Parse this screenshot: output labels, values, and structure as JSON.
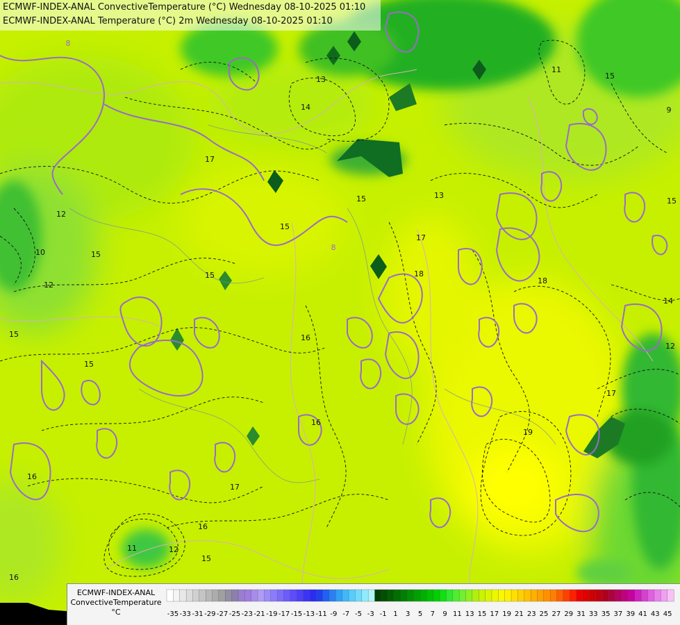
{
  "map": {
    "title_lines": [
      "ECMWF-INDEX-ANAL ConvectiveTemperature (°C) Wednesday 08-10-2025 01:10",
      "ECMWF-INDEX-ANAL Temperature (°C) 2m Wednesday 08-10-2025 01:10"
    ],
    "contour_labels": [
      {
        "text": "17",
        "color": "black"
      },
      {
        "text": "15",
        "color": "black"
      },
      {
        "text": "15",
        "color": "black"
      },
      {
        "text": "16",
        "color": "black"
      },
      {
        "text": "13",
        "color": "black"
      },
      {
        "text": "13",
        "color": "black"
      },
      {
        "text": "14",
        "color": "black"
      },
      {
        "text": "15",
        "color": "black"
      },
      {
        "text": "15",
        "color": "black"
      },
      {
        "text": "18",
        "color": "black"
      },
      {
        "text": "17",
        "color": "black"
      },
      {
        "text": "18",
        "color": "black"
      },
      {
        "text": "16",
        "color": "black"
      },
      {
        "text": "16",
        "color": "black"
      },
      {
        "text": "19",
        "color": "black"
      },
      {
        "text": "17",
        "color": "black"
      },
      {
        "text": "16",
        "color": "black"
      },
      {
        "text": "15",
        "color": "black"
      },
      {
        "text": "16",
        "color": "black"
      },
      {
        "text": "15",
        "color": "black"
      },
      {
        "text": "12",
        "color": "black"
      },
      {
        "text": "10",
        "color": "black"
      },
      {
        "text": "12",
        "color": "black"
      },
      {
        "text": "15",
        "color": "black"
      },
      {
        "text": "14",
        "color": "black"
      },
      {
        "text": "15",
        "color": "black"
      },
      {
        "text": "11",
        "color": "black"
      },
      {
        "text": "15",
        "color": "black"
      },
      {
        "text": "9",
        "color": "black"
      },
      {
        "text": "12",
        "color": "black"
      },
      {
        "text": "11",
        "color": "black"
      },
      {
        "text": "17",
        "color": "black"
      },
      {
        "text": "8",
        "color": "purple"
      },
      {
        "text": "8",
        "color": "purple"
      },
      {
        "text": "12",
        "color": "black"
      }
    ]
  },
  "legend": {
    "caption_lines": [
      "ECMWF-INDEX-ANAL",
      "ConvectiveTemperature",
      "°C"
    ],
    "tick_labels": [
      "-35",
      "-33",
      "-31",
      "-29",
      "-27",
      "-25",
      "-23",
      "-21",
      "-19",
      "-17",
      "-15",
      "-13",
      "-11",
      "-9",
      "-7",
      "-5",
      "-3",
      "-1",
      "1",
      "3",
      "5",
      "7",
      "9",
      "11",
      "13",
      "15",
      "17",
      "19",
      "21",
      "23",
      "25",
      "27",
      "29",
      "31",
      "33",
      "35",
      "37",
      "39",
      "41",
      "43",
      "45"
    ],
    "swatch_colors": [
      "#ffffff",
      "#f4f4f4",
      "#e8e8e8",
      "#dcdcdc",
      "#d0d0d0",
      "#c4c4c4",
      "#b8b8b8",
      "#acacac",
      "#a0a0a0",
      "#948fa4",
      "#8c80ac",
      "#9a7cd0",
      "#a07ce0",
      "#a88cec",
      "#b09cf4",
      "#9c8cf8",
      "#8c7cfc",
      "#7c6cfc",
      "#6c5cfc",
      "#5c4cfc",
      "#4c40f8",
      "#3c34f4",
      "#2c2cf0",
      "#2040f0",
      "#2060f4",
      "#2880f4",
      "#30a0f8",
      "#40b8f8",
      "#58ccfc",
      "#70dcfc",
      "#90ecfc",
      "#b0f4fc",
      "#004000",
      "#005000",
      "#006000",
      "#007000",
      "#008000",
      "#009000",
      "#00a000",
      "#00b000",
      "#00c000",
      "#00d000",
      "#10e010",
      "#30e830",
      "#50ec30",
      "#70f030",
      "#90f020",
      "#b0f010",
      "#c8f400",
      "#dcf400",
      "#ecf800",
      "#f8f800",
      "#fff000",
      "#ffe000",
      "#ffd000",
      "#ffc000",
      "#ffb000",
      "#ffa000",
      "#ff9000",
      "#ff8000",
      "#ff6000",
      "#ff4000",
      "#ff2000",
      "#f00000",
      "#e00000",
      "#d00000",
      "#c00010",
      "#b00020",
      "#b00040",
      "#b80060",
      "#c00080",
      "#c800a0",
      "#d020c0",
      "#d840d0",
      "#e060e0",
      "#e880ec",
      "#f0a0f0",
      "#f8c0f8"
    ]
  }
}
